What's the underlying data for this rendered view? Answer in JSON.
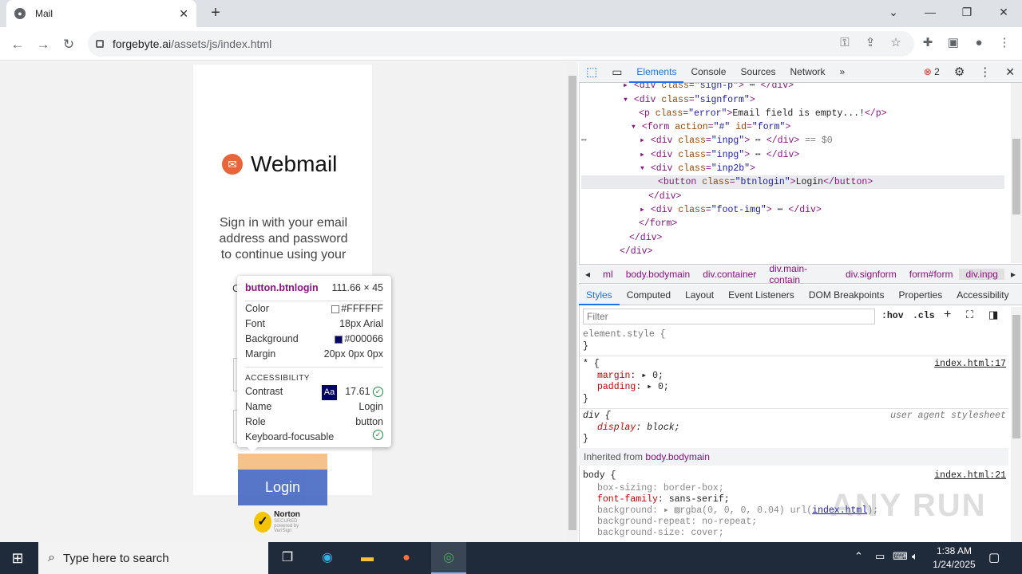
{
  "browser": {
    "tab_title": "Mail",
    "url_host": "forgebyte.ai",
    "url_path": "/assets/js/index.html"
  },
  "page": {
    "brand": "Webmail",
    "sign_text": "Sign in with your email address and password to continue using your",
    "sign_text_clip": "C",
    "login_label": "Login",
    "norton_line1": "Norton",
    "norton_line2": "SECURED",
    "norton_line3": "powered by VeriSign"
  },
  "tooltip": {
    "selector": "button.btnlogin",
    "size": "111.66 × 45",
    "rows": [
      {
        "k": "Color",
        "v": "#FFFFFF",
        "swatch": "#FFFFFF"
      },
      {
        "k": "Font",
        "v": "18px Arial"
      },
      {
        "k": "Background",
        "v": "#000066",
        "swatch": "#000066"
      },
      {
        "k": "Margin",
        "v": "20px 0px 0px"
      }
    ],
    "accessibility_heading": "ACCESSIBILITY",
    "contrast_label": "Contrast",
    "contrast_badge": "Aa",
    "contrast_value": "17.61",
    "name_label": "Name",
    "name_value": "Login",
    "role_label": "Role",
    "role_value": "button",
    "focus_label": "Keyboard-focusable"
  },
  "devtools": {
    "tabs": [
      "Elements",
      "Console",
      "Sources",
      "Network"
    ],
    "error_count": "2",
    "crumbs": [
      "ml",
      "body.bodymain",
      "div.container",
      "div.main-contain",
      "div.signform",
      "form#form",
      "div.inpg"
    ],
    "style_tabs": [
      "Styles",
      "Computed",
      "Layout",
      "Event Listeners",
      "DOM Breakpoints",
      "Properties",
      "Accessibility"
    ],
    "filter_placeholder": "Filter",
    "hov": ":hov",
    "cls": ".cls",
    "inherited_label": "Inherited from",
    "inherited_from": "body.bodymain",
    "dollar0": "== $0",
    "error_text": "Email field is empty...!",
    "button_text": "Login",
    "sources": {
      "star": "index.html:17",
      "body": "index.html:21",
      "ua": "user agent stylesheet"
    }
  },
  "taskbar": {
    "search_placeholder": "Type here to search",
    "time": "1:38 AM",
    "date": "1/24/2025"
  },
  "watermark": "ANY RUN",
  "colors": {
    "button_bg": "#000066",
    "accent": "#1a73e8",
    "tag": "#881280"
  }
}
